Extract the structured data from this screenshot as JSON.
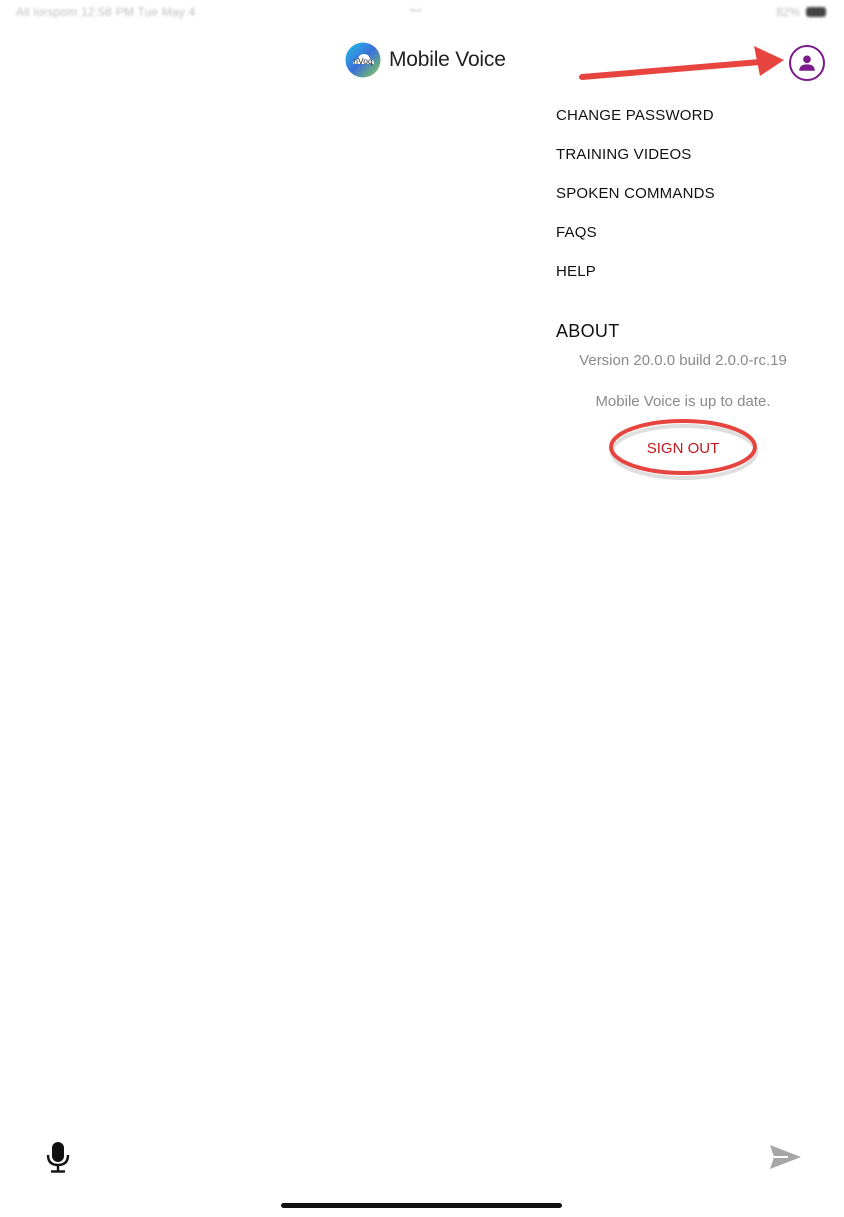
{
  "status_bar": {
    "left": "All lorspom  12:58 PM  Tue May 4",
    "center": "•••",
    "right": "82%"
  },
  "header": {
    "logo_text": "nVoq",
    "title": "Mobile Voice"
  },
  "menu": {
    "items": [
      {
        "label": "CHANGE PASSWORD"
      },
      {
        "label": "TRAINING VIDEOS"
      },
      {
        "label": "SPOKEN COMMANDS"
      },
      {
        "label": "FAQS"
      },
      {
        "label": "HELP"
      }
    ]
  },
  "about": {
    "heading": "ABOUT",
    "version": "Version 20.0.0  build 2.0.0-rc.19",
    "update_status": "Mobile Voice is up to date.",
    "sign_out_label": "SIGN OUT"
  },
  "icons": {
    "account": "user-circle-icon",
    "mic": "microphone-icon",
    "send": "send-icon"
  },
  "colors": {
    "accent_purple": "#7b1a8a",
    "sign_out_red": "#c0181f",
    "annotation_red": "#e8443f",
    "muted_text": "#8a8a8a"
  }
}
